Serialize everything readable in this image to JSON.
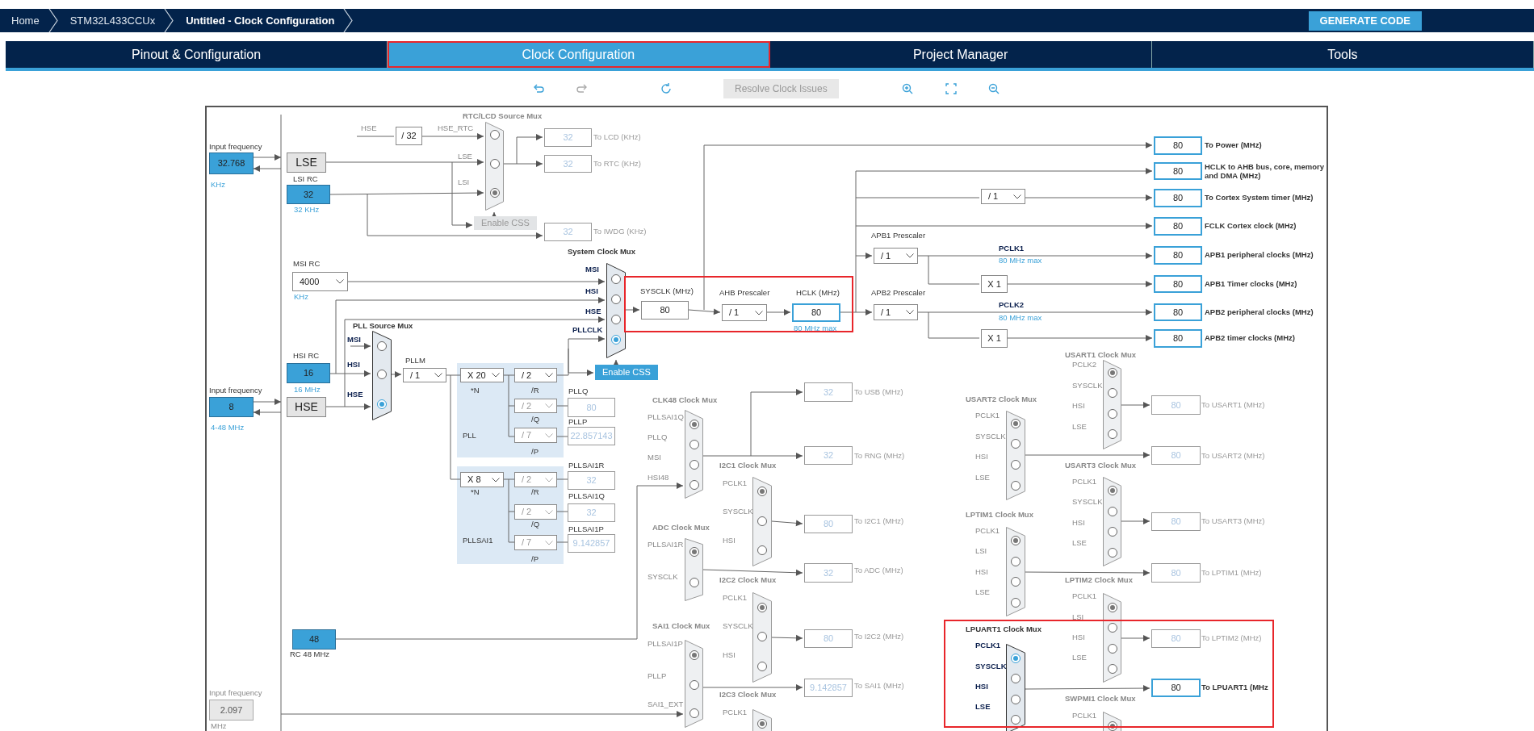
{
  "breadcrumbs": [
    {
      "label": "Home",
      "selected": false
    },
    {
      "label": "STM32L433CCUx",
      "selected": false
    },
    {
      "label": "Untitled - Clock Configuration",
      "selected": true
    }
  ],
  "generate_button": "GENERATE CODE",
  "tabs": [
    {
      "label": "Pinout & Configuration",
      "selected": false
    },
    {
      "label": "Clock Configuration",
      "selected": true
    },
    {
      "label": "Project Manager",
      "selected": false
    },
    {
      "label": "Tools",
      "selected": false
    }
  ],
  "toolbar": {
    "resolve_button": "Resolve Clock Issues",
    "resolve_disabled": true
  },
  "diagram": {
    "labels": [
      {
        "text": "Input frequency",
        "kind": "cap"
      },
      {
        "text": "KHz",
        "kind": "unit"
      },
      {
        "text": "LSI RC",
        "kind": "cap"
      },
      {
        "text": "32 KHz",
        "kind": "unit"
      },
      {
        "text": "HSE",
        "kind": "dim"
      },
      {
        "text": "HSE_RTC",
        "kind": "dim"
      },
      {
        "text": "RTC/LCD Source Mux",
        "kind": "title"
      },
      {
        "text": "LSE",
        "kind": "dim"
      },
      {
        "text": "LSI",
        "kind": "dim"
      },
      {
        "text": "To LCD (KHz)",
        "kind": "outdim"
      },
      {
        "text": "To RTC (KHz)",
        "kind": "outdim"
      },
      {
        "text": "To IWDG (KHz)",
        "kind": "outdim"
      },
      {
        "text": "System Clock Mux",
        "kind": "sigtitle"
      },
      {
        "text": "MSI RC",
        "kind": "cap"
      },
      {
        "text": "KHz",
        "kind": "unit"
      },
      {
        "text": "MSI",
        "kind": "sig"
      },
      {
        "text": "HSI",
        "kind": "sig"
      },
      {
        "text": "HSE",
        "kind": "sig"
      },
      {
        "text": "PLLCLK",
        "kind": "sig"
      },
      {
        "text": "SYSCLK (MHz)",
        "kind": "cap"
      },
      {
        "text": "HSI RC",
        "kind": "cap"
      },
      {
        "text": "16 MHz",
        "kind": "unit"
      },
      {
        "text": "PLL Source Mux",
        "kind": "sigtitle"
      },
      {
        "text": "MSI",
        "kind": "sig"
      },
      {
        "text": "HSI",
        "kind": "sig"
      },
      {
        "text": "HSE",
        "kind": "sig"
      },
      {
        "text": "PLLM",
        "kind": "cap"
      },
      {
        "text": "*N",
        "kind": "cap"
      },
      {
        "text": "/R",
        "kind": "cap"
      },
      {
        "text": "PLLQ",
        "kind": "cap"
      },
      {
        "text": "/Q",
        "kind": "cap"
      },
      {
        "text": "PLL",
        "kind": "cap"
      },
      {
        "text": "PLLP",
        "kind": "cap"
      },
      {
        "text": "/P",
        "kind": "cap"
      },
      {
        "text": "Input frequency",
        "kind": "cap"
      },
      {
        "text": "4-48 MHz",
        "kind": "unit"
      },
      {
        "text": "*N",
        "kind": "cap"
      },
      {
        "text": "/R",
        "kind": "cap"
      },
      {
        "text": "PLLSAI1R",
        "kind": "cap"
      },
      {
        "text": "/Q",
        "kind": "cap"
      },
      {
        "text": "PLLSAI1Q",
        "kind": "cap"
      },
      {
        "text": "/P",
        "kind": "cap"
      },
      {
        "text": "PLLSAI1P",
        "kind": "cap"
      },
      {
        "text": "PLLSAI1",
        "kind": "cap"
      },
      {
        "text": "RC 48 MHz",
        "kind": "cap"
      },
      {
        "text": "Input frequency",
        "kind": "dim"
      },
      {
        "text": "MHz",
        "kind": "dim"
      },
      {
        "text": "AHB Prescaler",
        "kind": "cap"
      },
      {
        "text": "HCLK (MHz)",
        "kind": "cap"
      },
      {
        "text": "80 MHz max",
        "kind": "unit"
      },
      {
        "text": "To Power (MHz)",
        "kind": "out"
      },
      {
        "text": "HCLK to AHB bus, core, memory and DMA (MHz)",
        "kind": "out"
      },
      {
        "text": "To Cortex System timer (MHz)",
        "kind": "out"
      },
      {
        "text": "FCLK Cortex clock (MHz)",
        "kind": "out"
      },
      {
        "text": "APB1 Prescaler",
        "kind": "cap"
      },
      {
        "text": "PCLK1",
        "kind": "sig"
      },
      {
        "text": "80 MHz max",
        "kind": "unit"
      },
      {
        "text": "APB1 peripheral clocks (MHz)",
        "kind": "out"
      },
      {
        "text": "APB1 Timer clocks (MHz)",
        "kind": "out"
      },
      {
        "text": "APB2 Prescaler",
        "kind": "cap"
      },
      {
        "text": "PCLK2",
        "kind": "sig"
      },
      {
        "text": "80 MHz max",
        "kind": "unit"
      },
      {
        "text": "APB2 peripheral clocks (MHz)",
        "kind": "out"
      },
      {
        "text": "APB2 timer clocks (MHz)",
        "kind": "out"
      },
      {
        "text": "USART1 Clock Mux",
        "kind": "title"
      },
      {
        "text": "CLK48 Clock Mux",
        "kind": "title"
      },
      {
        "text": "PLLSAI1Q",
        "kind": "dim"
      },
      {
        "text": "PLLQ",
        "kind": "dim"
      },
      {
        "text": "MSI",
        "kind": "dim"
      },
      {
        "text": "HSI48",
        "kind": "dim"
      },
      {
        "text": "ADC Clock Mux",
        "kind": "title"
      },
      {
        "text": "PLLSAI1R",
        "kind": "dim"
      },
      {
        "text": "SYSCLK",
        "kind": "dim"
      },
      {
        "text": "SAI1 Clock Mux",
        "kind": "title"
      },
      {
        "text": "PLLSAI1P",
        "kind": "dim"
      },
      {
        "text": "PLLP",
        "kind": "dim"
      },
      {
        "text": "SAI1_EXT",
        "kind": "dim"
      },
      {
        "text": "To USB (MHz)",
        "kind": "outdim"
      },
      {
        "text": "To RNG (MHz)",
        "kind": "outdim"
      },
      {
        "text": "I2C1 Clock Mux",
        "kind": "title"
      },
      {
        "text": "PCLK1",
        "kind": "dim"
      },
      {
        "text": "SYSCLK",
        "kind": "dim"
      },
      {
        "text": "HSI",
        "kind": "dim"
      },
      {
        "text": "To I2C1 (MHz)",
        "kind": "outdim"
      },
      {
        "text": "To ADC (MHz)",
        "kind": "outdim"
      },
      {
        "text": "I2C2 Clock Mux",
        "kind": "title"
      },
      {
        "text": "PCLK1",
        "kind": "dim"
      },
      {
        "text": "SYSCLK",
        "kind": "dim"
      },
      {
        "text": "HSI",
        "kind": "dim"
      },
      {
        "text": "To I2C2 (MHz)",
        "kind": "outdim"
      },
      {
        "text": "To SAI1 (MHz)",
        "kind": "outdim"
      },
      {
        "text": "I2C3 Clock Mux",
        "kind": "title"
      },
      {
        "text": "PCLK1",
        "kind": "dim"
      },
      {
        "text": "USART2 Clock Mux",
        "kind": "title"
      },
      {
        "text": "PCLK1",
        "kind": "dim"
      },
      {
        "text": "SYSCLK",
        "kind": "dim"
      },
      {
        "text": "HSI",
        "kind": "dim"
      },
      {
        "text": "LSE",
        "kind": "dim"
      },
      {
        "text": "PCLK2",
        "kind": "dim"
      },
      {
        "text": "SYSCLK",
        "kind": "dim"
      },
      {
        "text": "HSI",
        "kind": "dim"
      },
      {
        "text": "LSE",
        "kind": "dim"
      },
      {
        "text": "To USART1 (MHz)",
        "kind": "outdim"
      },
      {
        "text": "To USART2 (MHz)",
        "kind": "outdim"
      },
      {
        "text": "USART3 Clock Mux",
        "kind": "title"
      },
      {
        "text": "PCLK1",
        "kind": "dim"
      },
      {
        "text": "SYSCLK",
        "kind": "dim"
      },
      {
        "text": "HSI",
        "kind": "dim"
      },
      {
        "text": "LSE",
        "kind": "dim"
      },
      {
        "text": "To USART3 (MHz)",
        "kind": "outdim"
      },
      {
        "text": "LPTIM1 Clock Mux",
        "kind": "title"
      },
      {
        "text": "PCLK1",
        "kind": "dim"
      },
      {
        "text": "LSI",
        "kind": "dim"
      },
      {
        "text": "HSI",
        "kind": "dim"
      },
      {
        "text": "LSE",
        "kind": "dim"
      },
      {
        "text": "To LPTIM1 (MHz)",
        "kind": "outdim"
      },
      {
        "text": "LPTIM2 Clock Mux",
        "kind": "title"
      },
      {
        "text": "PCLK1",
        "kind": "dim"
      },
      {
        "text": "LSI",
        "kind": "dim"
      },
      {
        "text": "HSI",
        "kind": "dim"
      },
      {
        "text": "LSE",
        "kind": "dim"
      },
      {
        "text": "To LPTIM2 (MHz)",
        "kind": "outdim"
      },
      {
        "text": "LPUART1 Clock Mux",
        "kind": "sigtitle"
      },
      {
        "text": "PCLK1",
        "kind": "sig"
      },
      {
        "text": "SYSCLK",
        "kind": "sig"
      },
      {
        "text": "HSI",
        "kind": "sig"
      },
      {
        "text": "LSE",
        "kind": "sig"
      },
      {
        "text": "To LPUART1 (MHz",
        "kind": "out"
      },
      {
        "text": "SWPMI1 Clock Mux",
        "kind": "title"
      },
      {
        "text": "PCLK1",
        "kind": "dim"
      }
    ],
    "value_boxes": [
      {
        "value": "32.768",
        "kind": "input"
      },
      {
        "value": "LSE",
        "kind": "source"
      },
      {
        "value": "32",
        "kind": "input"
      },
      {
        "value": "/ 32",
        "kind": "plain"
      },
      {
        "value": "32",
        "kind": "inactive"
      },
      {
        "value": "32",
        "kind": "inactive"
      },
      {
        "value": "32",
        "kind": "inactive"
      },
      {
        "value": "80",
        "kind": "plain"
      },
      {
        "value": "16",
        "kind": "input"
      },
      {
        "value": "8",
        "kind": "input"
      },
      {
        "value": "HSE",
        "kind": "source"
      },
      {
        "value": "80",
        "kind": "inactive"
      },
      {
        "value": "22.857143",
        "kind": "inactive"
      },
      {
        "value": "32",
        "kind": "inactive"
      },
      {
        "value": "32",
        "kind": "inactive"
      },
      {
        "value": "9.142857",
        "kind": "inactive"
      },
      {
        "value": "48",
        "kind": "input"
      },
      {
        "value": "2.097",
        "kind": "disabled"
      },
      {
        "value": "80",
        "kind": "output"
      },
      {
        "value": "80",
        "kind": "output"
      },
      {
        "value": "80",
        "kind": "output"
      },
      {
        "value": "80",
        "kind": "output"
      },
      {
        "value": "80",
        "kind": "output"
      },
      {
        "value": "80",
        "kind": "output"
      },
      {
        "value": "80",
        "kind": "output"
      },
      {
        "value": "80",
        "kind": "output"
      },
      {
        "value": "80",
        "kind": "output"
      },
      {
        "value": "X 1",
        "kind": "plain"
      },
      {
        "value": "X 1",
        "kind": "plain"
      },
      {
        "value": "32",
        "kind": "inactive"
      },
      {
        "value": "32",
        "kind": "inactive"
      },
      {
        "value": "80",
        "kind": "inactive"
      },
      {
        "value": "32",
        "kind": "inactive"
      },
      {
        "value": "80",
        "kind": "inactive"
      },
      {
        "value": "9.142857",
        "kind": "inactive"
      },
      {
        "value": "80",
        "kind": "inactive"
      },
      {
        "value": "80",
        "kind": "inactive"
      },
      {
        "value": "80",
        "kind": "inactive"
      },
      {
        "value": "80",
        "kind": "inactive"
      },
      {
        "value": "80",
        "kind": "inactive"
      },
      {
        "value": "80",
        "kind": "output"
      }
    ],
    "dropdowns": [
      {
        "value": "4000",
        "disabled": false
      },
      {
        "value": "/ 1",
        "disabled": false
      },
      {
        "value": "X 20",
        "disabled": false
      },
      {
        "value": "/ 2",
        "disabled": false
      },
      {
        "value": "/ 2",
        "disabled": true
      },
      {
        "value": "/ 7",
        "disabled": true
      },
      {
        "value": "X 8",
        "disabled": false
      },
      {
        "value": "/ 2",
        "disabled": true
      },
      {
        "value": "/ 2",
        "disabled": true
      },
      {
        "value": "/ 7",
        "disabled": true
      },
      {
        "value": "/ 1",
        "disabled": false
      },
      {
        "value": "/ 1",
        "disabled": false
      },
      {
        "value": "/ 1",
        "disabled": false
      },
      {
        "value": "/ 1",
        "disabled": false
      }
    ],
    "buttons": [
      {
        "label": "Enable CSS",
        "enabled": false
      },
      {
        "label": "Enable CSS",
        "enabled": true
      }
    ],
    "muxes": [
      {
        "active": false,
        "options": [
          {
            "selected": false
          },
          {
            "selected": false
          },
          {
            "selected": true
          }
        ]
      },
      {
        "active": true,
        "options": [
          {
            "selected": false
          },
          {
            "selected": false
          },
          {
            "selected": false
          },
          {
            "selected": true
          }
        ]
      },
      {
        "active": true,
        "options": [
          {
            "selected": false
          },
          {
            "selected": false
          },
          {
            "selected": true
          }
        ]
      },
      {
        "active": false,
        "options": [
          {
            "selected": true
          },
          {
            "selected": false
          },
          {
            "selected": false
          },
          {
            "selected": false
          }
        ]
      },
      {
        "active": false,
        "options": [
          {
            "selected": true
          },
          {
            "selected": false
          }
        ]
      },
      {
        "active": false,
        "options": [
          {
            "selected": true
          },
          {
            "selected": false
          },
          {
            "selected": false
          }
        ]
      },
      {
        "active": false,
        "options": [
          {
            "selected": true
          },
          {
            "selected": false
          },
          {
            "selected": false
          }
        ]
      },
      {
        "active": false,
        "options": [
          {
            "selected": true
          },
          {
            "selected": false
          },
          {
            "selected": false
          }
        ]
      },
      {
        "active": false,
        "options": [
          {
            "selected": true
          }
        ]
      },
      {
        "active": false,
        "options": [
          {
            "selected": true
          },
          {
            "selected": false
          },
          {
            "selected": false
          },
          {
            "selected": false
          }
        ]
      },
      {
        "active": false,
        "options": [
          {
            "selected": true
          },
          {
            "selected": false
          },
          {
            "selected": false
          },
          {
            "selected": false
          }
        ]
      },
      {
        "active": false,
        "options": [
          {
            "selected": true
          },
          {
            "selected": false
          },
          {
            "selected": false
          },
          {
            "selected": false
          }
        ]
      },
      {
        "active": false,
        "options": [
          {
            "selected": true
          },
          {
            "selected": false
          },
          {
            "selected": false
          },
          {
            "selected": false
          }
        ]
      },
      {
        "active": false,
        "options": [
          {
            "selected": true
          },
          {
            "selected": false
          },
          {
            "selected": false
          },
          {
            "selected": false
          }
        ]
      },
      {
        "active": true,
        "options": [
          {
            "selected": true
          },
          {
            "selected": false
          },
          {
            "selected": false
          },
          {
            "selected": false
          }
        ]
      },
      {
        "active": false,
        "options": [
          {
            "selected": true
          }
        ]
      }
    ]
  }
}
